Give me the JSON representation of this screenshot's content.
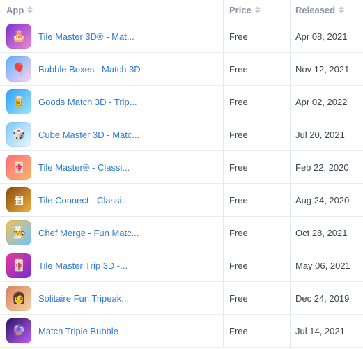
{
  "header": {
    "app": "App",
    "price": "Price",
    "released": "Released"
  },
  "rows": [
    {
      "name": "Tile Master 3D® - Mat...",
      "price": "Free",
      "released": "Apr 08, 2021",
      "icon": "cake-icon",
      "icon_glyph": "🎂",
      "colors": [
        "#7b2fd8",
        "#f08acb"
      ]
    },
    {
      "name": "Bubble Boxes : Match 3D",
      "price": "Free",
      "released": "Nov 12, 2021",
      "icon": "balloons-icon",
      "icon_glyph": "🎈",
      "colors": [
        "#5fb3ff",
        "#ffd1f0"
      ]
    },
    {
      "name": "Goods Match 3D - Trip...",
      "price": "Free",
      "released": "Apr 02, 2022",
      "icon": "goods-icon",
      "icon_glyph": "🥫",
      "colors": [
        "#2ea0ff",
        "#9de6ff"
      ]
    },
    {
      "name": "Cube Master 3D - Matc...",
      "price": "Free",
      "released": "Jul 20, 2021",
      "icon": "dice-icon",
      "icon_glyph": "🎲",
      "colors": [
        "#7cc9ff",
        "#e8f7ff"
      ]
    },
    {
      "name": "Tile Master® - Classi...",
      "price": "Free",
      "released": "Feb 22, 2020",
      "icon": "tile-icon",
      "icon_glyph": "🀄",
      "colors": [
        "#ff6f7a",
        "#ffb36b"
      ]
    },
    {
      "name": "Tile Connect - Classi...",
      "price": "Free",
      "released": "Aug 24, 2020",
      "icon": "tile-grid-icon",
      "icon_glyph": "▦",
      "colors": [
        "#8a4a12",
        "#f0b23c"
      ]
    },
    {
      "name": "Chef Merge - Fun Matc...",
      "price": "Free",
      "released": "Oct 28, 2021",
      "icon": "chef-icon",
      "icon_glyph": "👨‍🍳",
      "colors": [
        "#f2c15a",
        "#6ec3ff"
      ]
    },
    {
      "name": "Tile Master Trip 3D -...",
      "price": "Free",
      "released": "May 06, 2021",
      "icon": "tile-pink-icon",
      "icon_glyph": "🀄",
      "colors": [
        "#e43d9a",
        "#7a2bd1"
      ]
    },
    {
      "name": "Solitaire Fun Tripeak...",
      "price": "Free",
      "released": "Dec 24, 2019",
      "icon": "girl-portrait-icon",
      "icon_glyph": "👩",
      "colors": [
        "#d9825f",
        "#f7d3a5"
      ]
    },
    {
      "name": "Match Triple Bubble -...",
      "price": "Free",
      "released": "Jul 14, 2021",
      "icon": "bubble-icon",
      "icon_glyph": "🔮",
      "colors": [
        "#2b1560",
        "#c35cff"
      ]
    }
  ]
}
